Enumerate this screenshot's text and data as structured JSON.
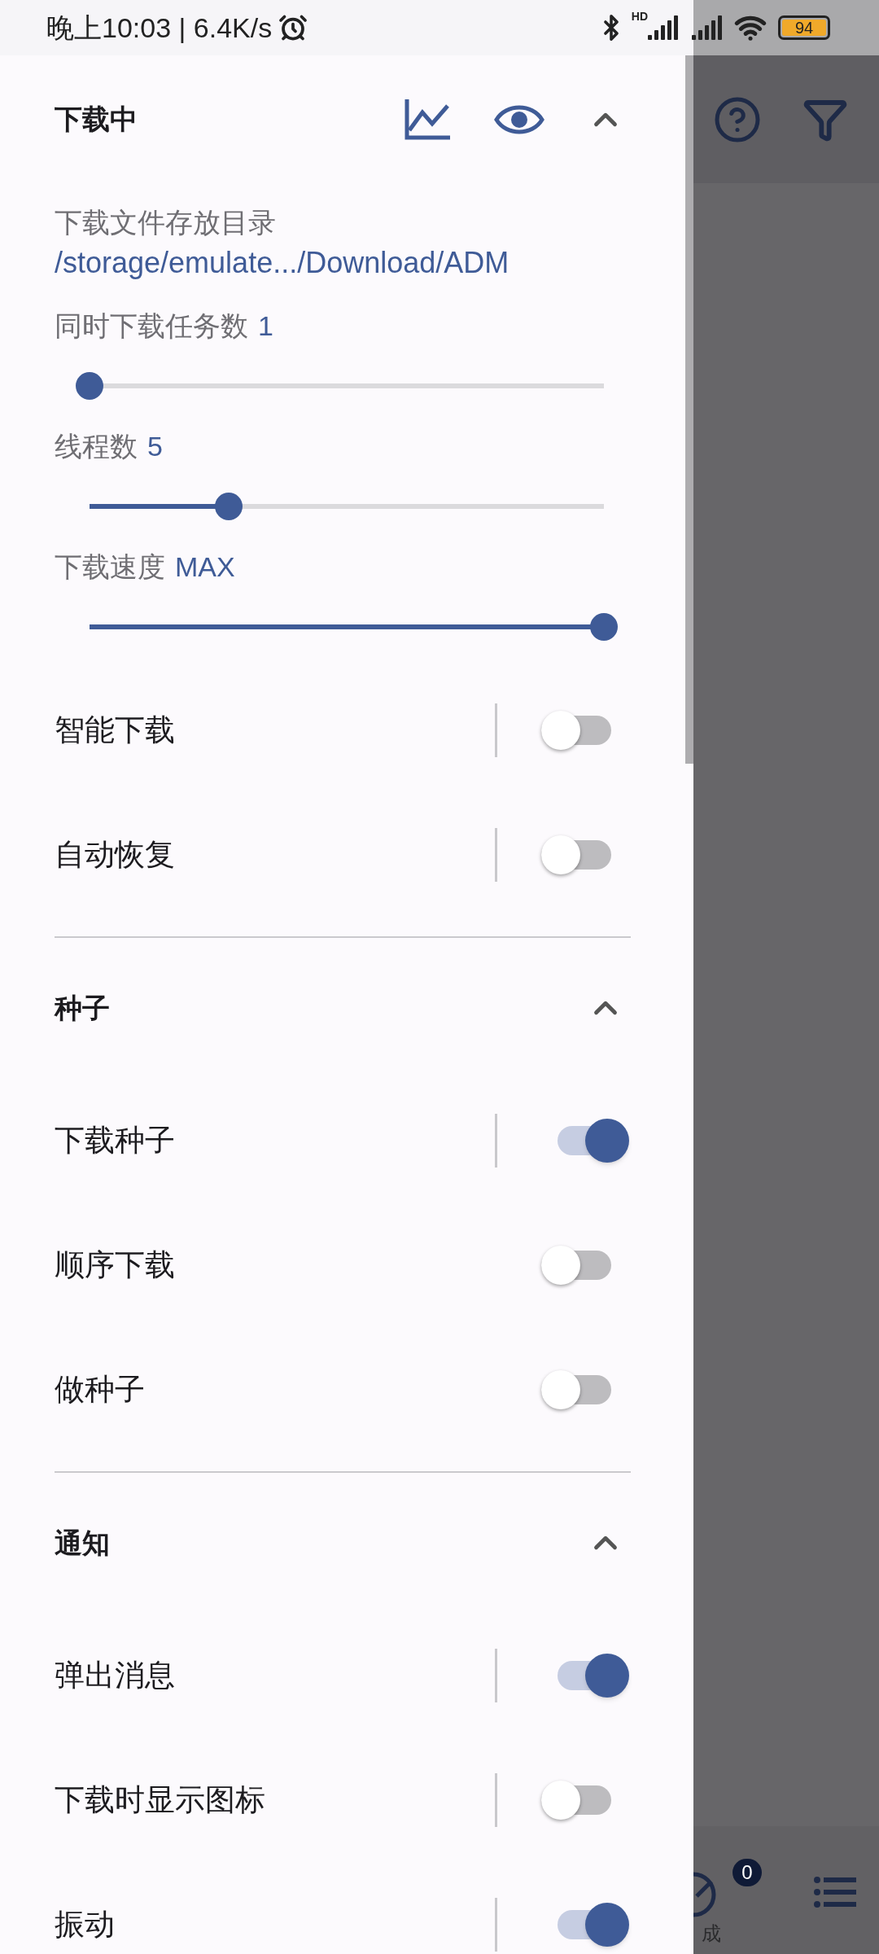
{
  "status_bar": {
    "time": "晚上10:03 | 6.4K/s",
    "network_type": "HD",
    "battery": "94"
  },
  "drawer": {
    "sections": [
      {
        "title": "下载中",
        "expanded": true,
        "tools": [
          {
            "kind": "chart"
          },
          {
            "kind": "visibility"
          }
        ],
        "items": [
          {
            "kind": "path",
            "label": "下载文件存放目录",
            "value": "/storage/emulate.../Download/ADM"
          },
          {
            "kind": "slider",
            "label": "同时下载任务数",
            "value": "1",
            "level": 0
          },
          {
            "kind": "slider",
            "label": "线程数",
            "value": "5",
            "level": 0.27
          },
          {
            "kind": "slider",
            "label": "下载速度",
            "value": "MAX",
            "level": 1
          },
          {
            "kind": "switch",
            "label": "智能下载",
            "on": false,
            "divider": true
          },
          {
            "kind": "switch",
            "label": "自动恢复",
            "on": false,
            "divider": true
          }
        ]
      },
      {
        "title": "种子",
        "expanded": true,
        "items": [
          {
            "kind": "switch",
            "label": "下载种子",
            "on": true,
            "divider": true
          },
          {
            "kind": "switch",
            "label": "顺序下载",
            "on": false,
            "divider": false
          },
          {
            "kind": "switch",
            "label": "做种子",
            "on": false,
            "divider": false
          }
        ]
      },
      {
        "title": "通知",
        "expanded": true,
        "items": [
          {
            "kind": "switch",
            "label": "弹出消息",
            "on": true,
            "divider": true
          },
          {
            "kind": "switch",
            "label": "下载时显示图标",
            "on": false,
            "divider": true
          },
          {
            "kind": "switch",
            "label": "振动",
            "on": true,
            "divider": true
          }
        ]
      }
    ]
  },
  "background_app": {
    "completed_tab": {
      "label": "成",
      "badge": "0"
    }
  }
}
